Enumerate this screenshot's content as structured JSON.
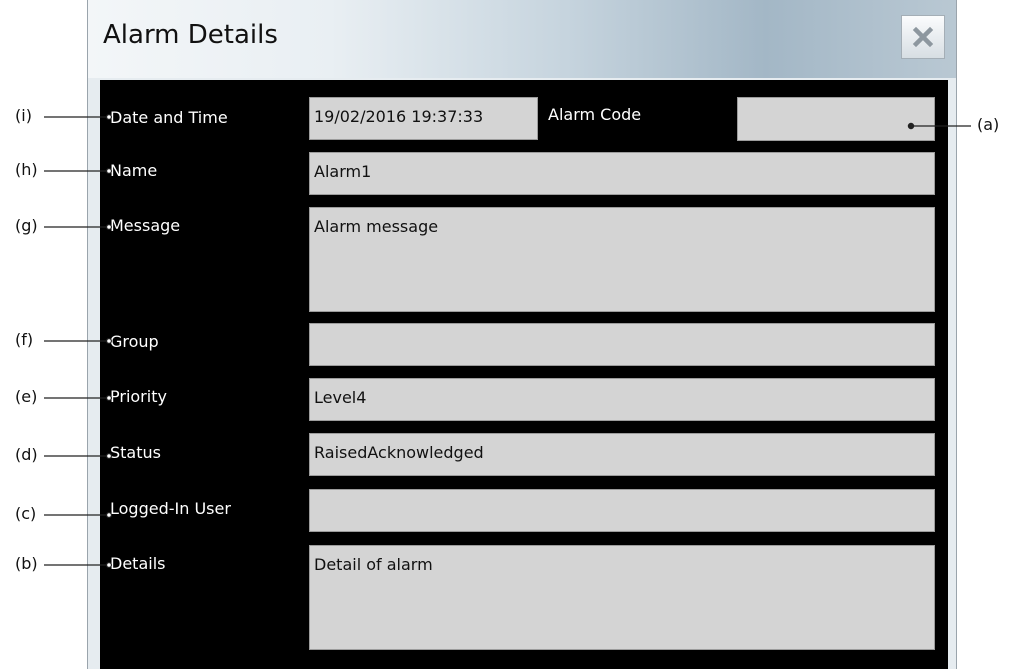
{
  "dialog": {
    "title": "Alarm Details",
    "close_icon": "close-icon"
  },
  "fields": {
    "date_time": {
      "label": "Date and Time",
      "value": "19/02/2016 19:37:33"
    },
    "alarm_code": {
      "label": "Alarm Code",
      "value": ""
    },
    "name": {
      "label": "Name",
      "value": "Alarm1"
    },
    "message": {
      "label": "Message",
      "value": "Alarm message"
    },
    "group": {
      "label": "Group",
      "value": ""
    },
    "priority": {
      "label": "Priority",
      "value": "Level4"
    },
    "status": {
      "label": "Status",
      "value": "RaisedAcknowledged"
    },
    "logged_in_user": {
      "label": "Logged-In User",
      "value": ""
    },
    "details": {
      "label": "Details",
      "value": "Detail of alarm"
    }
  },
  "callouts": {
    "a": "(a)",
    "b": "(b)",
    "c": "(c)",
    "d": "(d)",
    "e": "(e)",
    "f": "(f)",
    "g": "(g)",
    "h": "(h)",
    "i": "(i)"
  },
  "colors": {
    "content_background": "#000000",
    "field_background": "#d4d4d4",
    "label_text": "#ffffff"
  }
}
